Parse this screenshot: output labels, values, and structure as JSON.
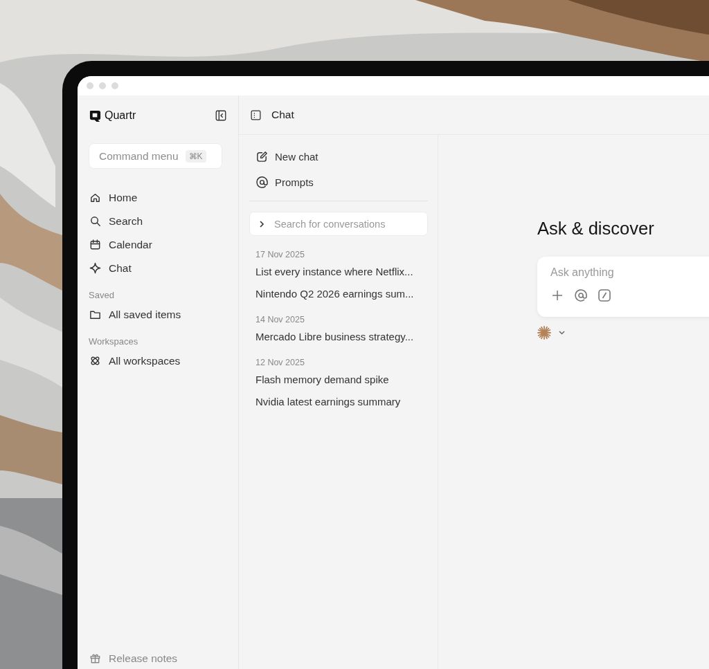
{
  "sidebar": {
    "brand": "Quartr",
    "command_menu": {
      "label": "Command menu",
      "shortcut": "⌘K"
    },
    "nav": [
      {
        "label": "Home",
        "kind": "home"
      },
      {
        "label": "Search",
        "kind": "search"
      },
      {
        "label": "Calendar",
        "kind": "calendar"
      },
      {
        "label": "Chat",
        "kind": "sparkle"
      }
    ],
    "sections": [
      {
        "heading": "Saved",
        "items": [
          {
            "label": "All saved items",
            "kind": "folder"
          }
        ]
      },
      {
        "heading": "Workspaces",
        "items": [
          {
            "label": "All workspaces",
            "kind": "atom"
          }
        ]
      }
    ],
    "footer": {
      "label": "Release notes",
      "kind": "gift"
    }
  },
  "header": {
    "title": "Chat"
  },
  "chat_panel": {
    "actions": [
      {
        "label": "New chat",
        "kind": "edit"
      },
      {
        "label": "Prompts",
        "kind": "at"
      }
    ],
    "search": {
      "placeholder": "Search for conversations"
    },
    "groups": [
      {
        "date": "17 Nov 2025",
        "conversations": [
          "List every instance where Netflix...",
          "Nintendo Q2 2026 earnings sum..."
        ]
      },
      {
        "date": "14 Nov 2025",
        "conversations": [
          "Mercado Libre business strategy..."
        ]
      },
      {
        "date": "12 Nov 2025",
        "conversations": [
          "Flash memory demand spike",
          "Nvidia latest earnings summary"
        ]
      }
    ]
  },
  "main": {
    "heading": "Ask & discover",
    "composer": {
      "placeholder": "Ask anything"
    }
  }
}
